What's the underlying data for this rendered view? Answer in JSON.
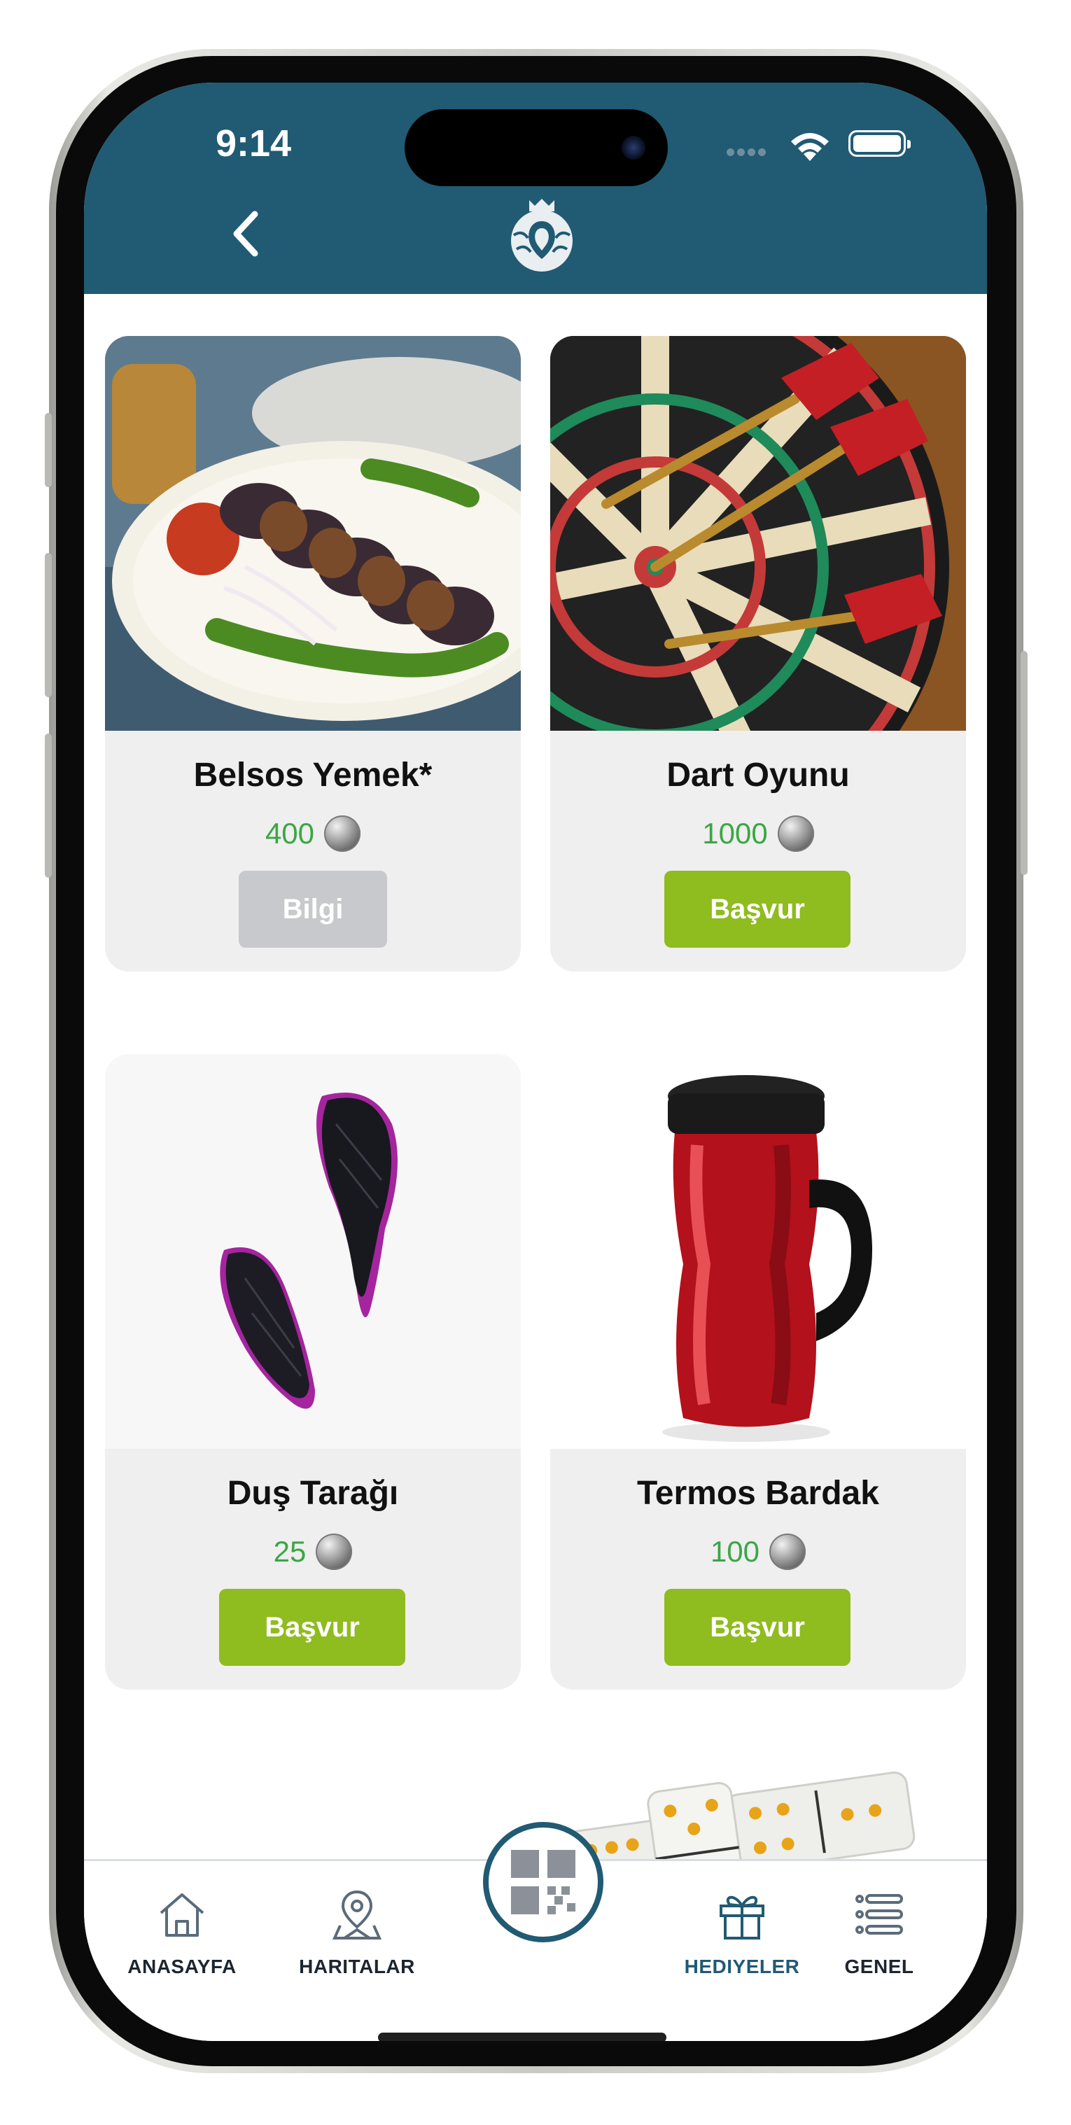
{
  "status_bar": {
    "time": "9:14"
  },
  "header": {
    "back_icon": "chevron-left-icon",
    "logo_icon": "municipality-logo"
  },
  "products": [
    {
      "title": "Belsos Yemek*",
      "price": "400",
      "button": "Bilgi",
      "button_state": "disabled",
      "image": "kebab-plate"
    },
    {
      "title": "Dart Oyunu",
      "price": "1000",
      "button": "Başvur",
      "button_state": "active",
      "image": "dartboard"
    },
    {
      "title": "Duş Tarağı",
      "price": "25",
      "button": "Başvur",
      "button_state": "active",
      "image": "hair-brush"
    },
    {
      "title": "Termos Bardak",
      "price": "100",
      "button": "Başvur",
      "button_state": "active",
      "image": "thermos-mug"
    }
  ],
  "bottom_nav": {
    "items": [
      {
        "label": "ANASAYFA",
        "icon": "home-icon",
        "active": false
      },
      {
        "label": "HARITALAR",
        "icon": "map-pin-icon",
        "active": false
      },
      {
        "label": "HEDIYELER",
        "icon": "gift-icon",
        "active": true
      },
      {
        "label": "GENEL",
        "icon": "list-icon",
        "active": false
      }
    ],
    "center_icon": "qr-code-icon"
  },
  "colors": {
    "header": "#215a73",
    "button_green": "#8fbc1e",
    "button_gray": "#c8c9cc",
    "price_green": "#3aa744",
    "card_bg": "#efefef"
  }
}
